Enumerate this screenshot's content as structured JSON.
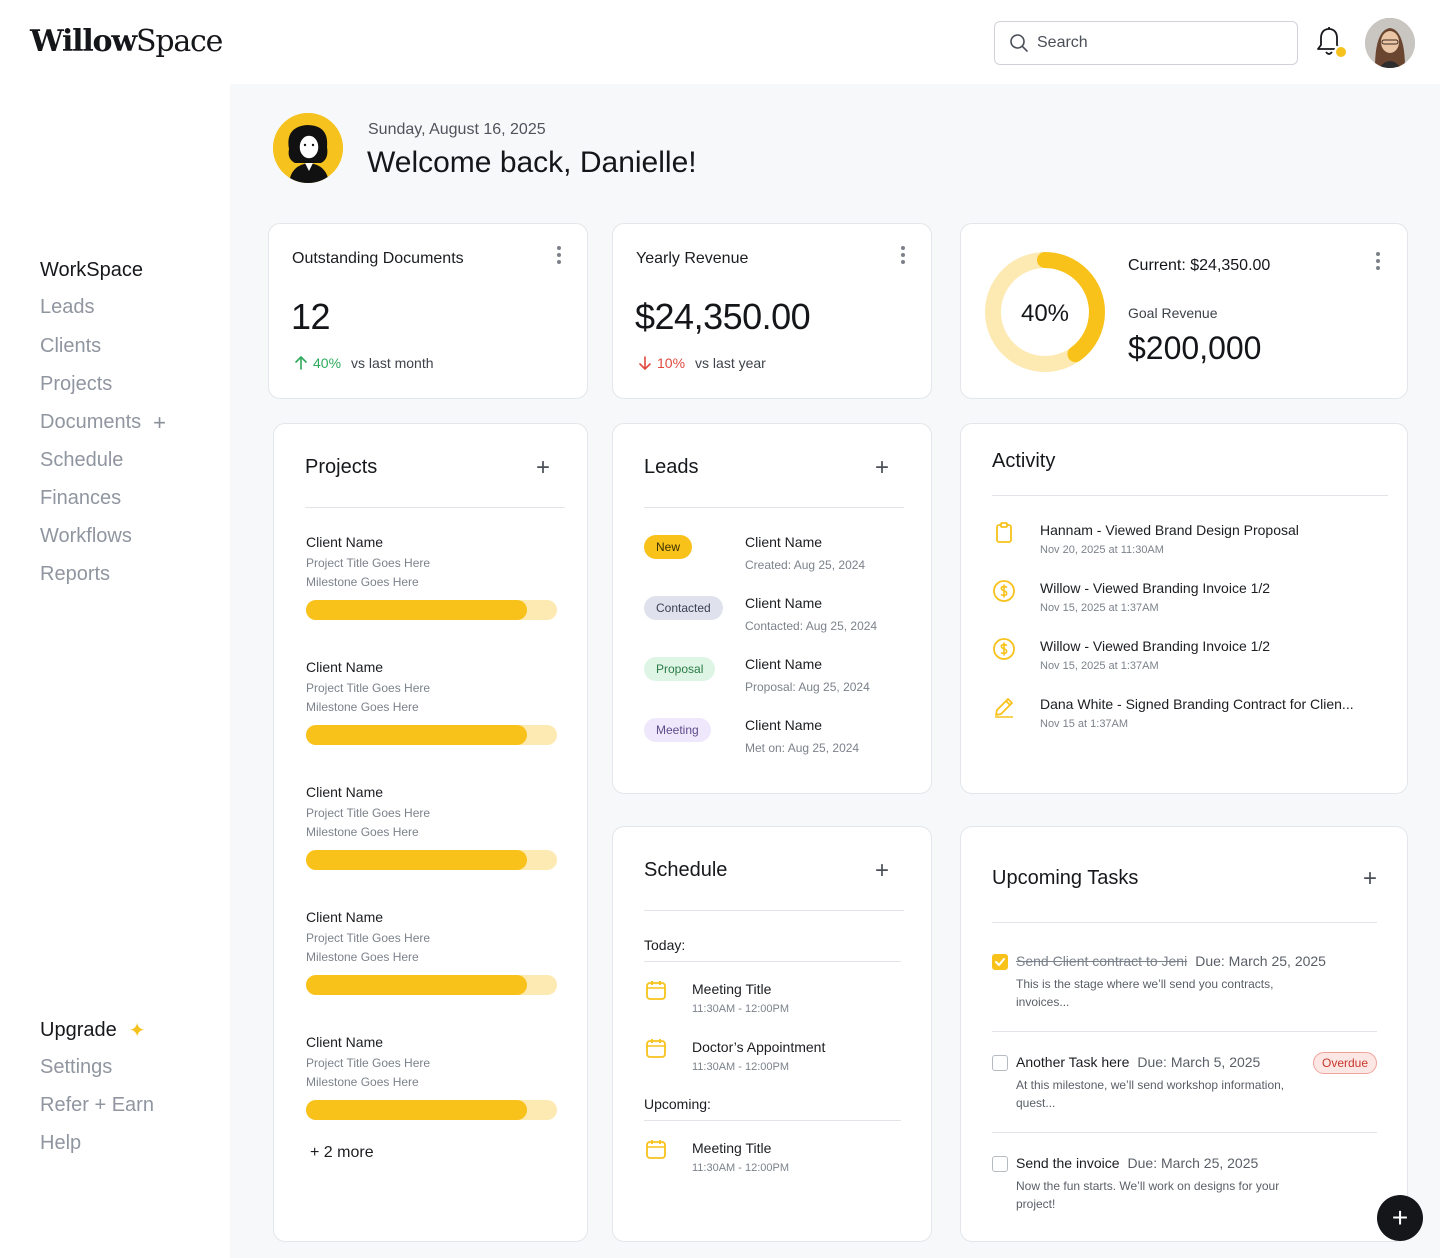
{
  "app": {
    "logo_bold": "Willow",
    "logo_light": "Space"
  },
  "header": {
    "search_placeholder": "Search"
  },
  "sidebar": {
    "items": [
      {
        "label": "WorkSpace",
        "active": true
      },
      {
        "label": "Leads"
      },
      {
        "label": "Clients"
      },
      {
        "label": "Projects"
      },
      {
        "label": "Documents"
      },
      {
        "label": "Schedule"
      },
      {
        "label": "Finances"
      },
      {
        "label": "Workflows"
      },
      {
        "label": "Reports"
      }
    ],
    "bottom": [
      {
        "label": "Upgrade"
      },
      {
        "label": "Settings"
      },
      {
        "label": "Refer + Earn"
      },
      {
        "label": "Help"
      }
    ]
  },
  "welcome": {
    "date": "Sunday, August 16, 2025",
    "greeting": "Welcome back, Danielle!"
  },
  "stats": {
    "docs": {
      "label": "Outstanding Documents",
      "value": "12",
      "delta": "40%",
      "compare": "vs last month",
      "direction": "up"
    },
    "revenue": {
      "label": "Yearly Revenue",
      "value": "$24,350.00",
      "delta": "10%",
      "compare": "vs last year",
      "direction": "down"
    },
    "goal": {
      "percent_label": "40%",
      "percent": 0.4,
      "current": "Current: $24,350.00",
      "goal_label": "Goal Revenue",
      "goal_value": "$200,000"
    }
  },
  "projects": {
    "title": "Projects",
    "items": [
      {
        "client": "Client Name",
        "title": "Project Title Goes Here",
        "milestone": "Milestone Goes Here",
        "progress": 0.88
      },
      {
        "client": "Client Name",
        "title": "Project Title Goes Here",
        "milestone": "Milestone Goes Here",
        "progress": 0.88
      },
      {
        "client": "Client Name",
        "title": "Project Title Goes Here",
        "milestone": "Milestone Goes Here",
        "progress": 0.88
      },
      {
        "client": "Client Name",
        "title": "Project Title Goes Here",
        "milestone": "Milestone Goes Here",
        "progress": 0.88
      },
      {
        "client": "Client Name",
        "title": "Project Title Goes Here",
        "milestone": "Milestone Goes Here",
        "progress": 0.88
      }
    ],
    "more": "+ 2 more"
  },
  "leads": {
    "title": "Leads",
    "items": [
      {
        "status": "New",
        "client": "Client Name",
        "detail": "Created: Aug 25, 2024",
        "color": "#f8c21b"
      },
      {
        "status": "Contacted",
        "client": "Client Name",
        "detail": "Contacted: Aug 25, 2024",
        "color": "#dfe2ec"
      },
      {
        "status": "Proposal",
        "client": "Client Name",
        "detail": "Proposal: Aug 25, 2024",
        "color": "#def5e6"
      },
      {
        "status": "Meeting",
        "client": "Client Name",
        "detail": "Met on: Aug 25, 2024",
        "color": "#efe7fb"
      }
    ]
  },
  "activity": {
    "title": "Activity",
    "items": [
      {
        "icon": "clipboard-icon",
        "text": "Hannam - Viewed Brand Design Proposal",
        "time": "Nov 20, 2025 at 11:30AM"
      },
      {
        "icon": "dollar-icon",
        "text": "Willow - Viewed Branding Invoice 1/2",
        "time": "Nov 15, 2025 at 1:37AM"
      },
      {
        "icon": "dollar-icon",
        "text": "Willow - Viewed Branding Invoice 1/2",
        "time": "Nov 15, 2025 at 1:37AM"
      },
      {
        "icon": "pen-icon",
        "text": "Dana White - Signed Branding Contract for Clien...",
        "time": "Nov 15 at 1:37AM"
      }
    ]
  },
  "schedule": {
    "title": "Schedule",
    "today_label": "Today:",
    "upcoming_label": "Upcoming:",
    "today": [
      {
        "title": "Meeting Title",
        "time": "11:30AM - 12:00PM"
      },
      {
        "title": "Doctor’s Appointment",
        "time": "11:30AM - 12:00PM"
      }
    ],
    "upcoming": [
      {
        "title": "Meeting Title",
        "time": "11:30AM - 12:00PM"
      }
    ]
  },
  "tasks": {
    "title": "Upcoming Tasks",
    "items": [
      {
        "name": "Send Client contract to Jeni",
        "due": "Due: March 25, 2025",
        "desc": "This is the stage where we’ll send you contracts, invoices...",
        "done": true
      },
      {
        "name": "Another Task here",
        "due": "Due: March 5, 2025",
        "desc": "At this milestone, we’ll send workshop information, quest...",
        "done": false,
        "badge": "Overdue"
      },
      {
        "name": "Send the invoice",
        "due": "Due: March 25, 2025",
        "desc": "Now the fun starts. We’ll work on designs for your project!",
        "done": false
      }
    ]
  },
  "colors": {
    "accent": "#f8c21b",
    "accent_light": "#fde9b2",
    "up": "#2daa5c",
    "down": "#e0493e"
  }
}
